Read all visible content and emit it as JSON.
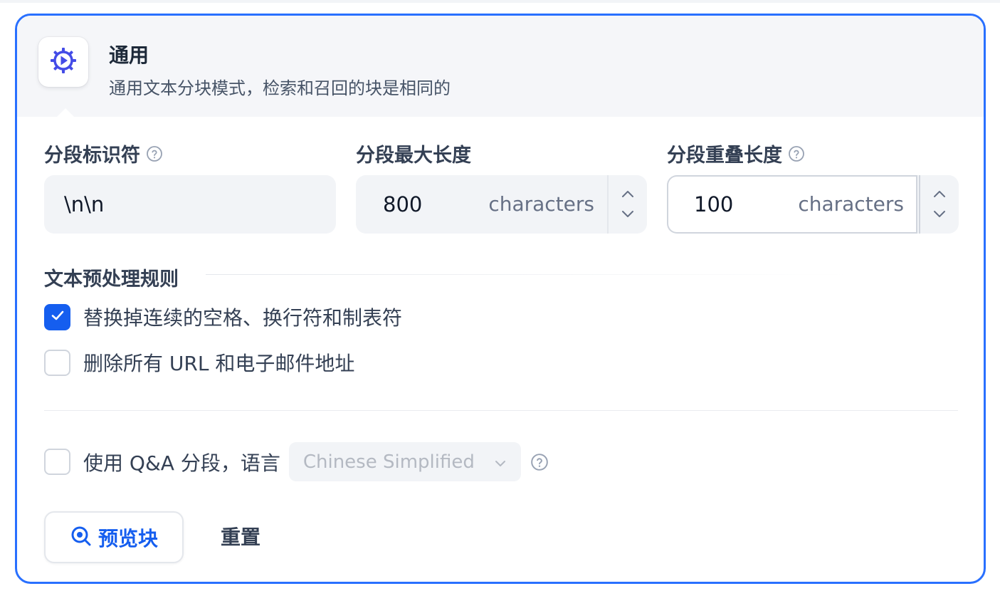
{
  "header": {
    "title": "通用",
    "description": "通用文本分块模式，检索和召回的块是相同的",
    "icon": "gear-play-icon"
  },
  "fields": {
    "separator": {
      "label": "分段标识符",
      "value": "\\n\\n"
    },
    "max_length": {
      "label": "分段最大长度",
      "value": "800",
      "unit": "characters"
    },
    "overlap": {
      "label": "分段重叠长度",
      "value": "100",
      "unit": "characters"
    }
  },
  "preprocessing": {
    "title": "文本预处理规则",
    "rules": [
      {
        "label": "替换掉连续的空格、换行符和制表符",
        "checked": true
      },
      {
        "label": "删除所有 URL 和电子邮件地址",
        "checked": false
      }
    ]
  },
  "qa": {
    "label": "使用 Q&A 分段，语言",
    "checked": false,
    "language": "Chinese Simplified"
  },
  "actions": {
    "preview_label": "预览块",
    "reset_label": "重置"
  },
  "colors": {
    "accent": "#2970ff",
    "primary": "#155eef",
    "icon": "#444ce7"
  }
}
